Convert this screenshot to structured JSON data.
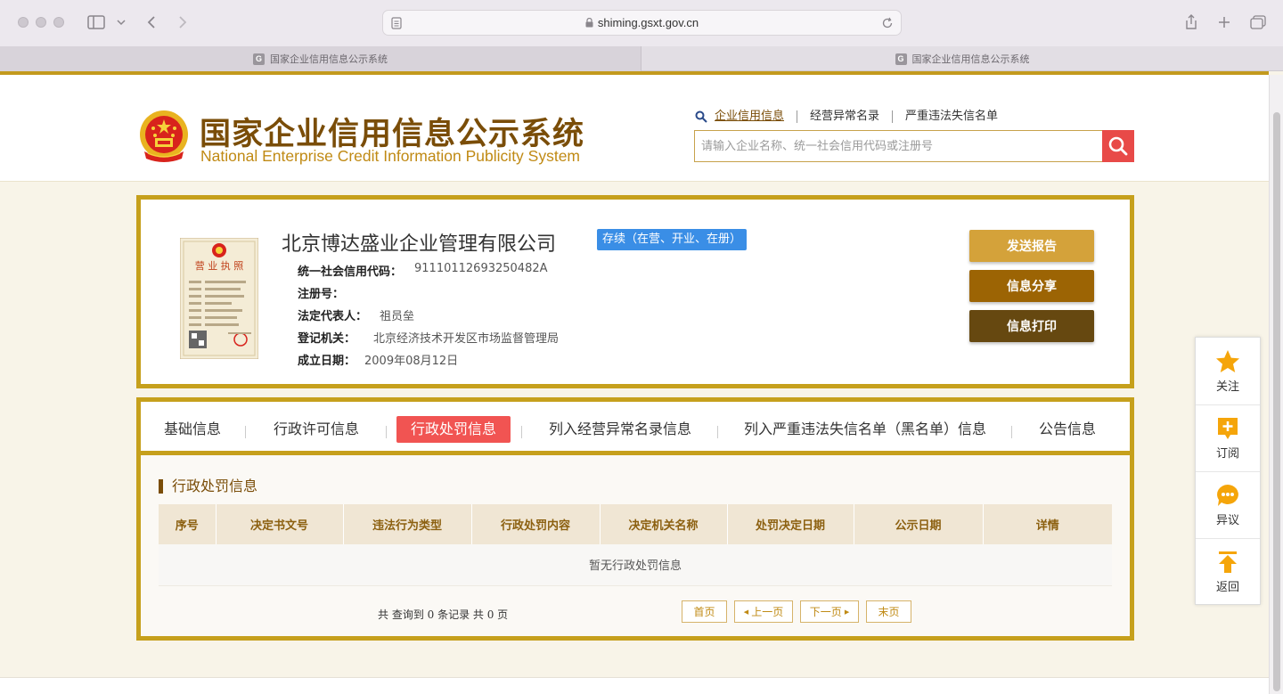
{
  "browser": {
    "url": "shiming.gsxt.gov.cn",
    "tabs": [
      {
        "title": "国家企业信用信息公示系统",
        "favicon": "G"
      },
      {
        "title": "国家企业信用信息公示系统",
        "favicon": "G"
      }
    ]
  },
  "header": {
    "title_cn": "国家企业信用信息公示系统",
    "title_en": "National Enterprise Credit Information Publicity System",
    "search_links": [
      "企业信用信息",
      "经营异常名录",
      "严重违法失信名单"
    ],
    "search_placeholder": "请输入企业名称、统一社会信用代码或注册号"
  },
  "company": {
    "name": "北京博达盛业企业管理有限公司",
    "status": "存续（在营、开业、在册）",
    "fields": [
      {
        "label": "统一社会信用代码：",
        "value": "91110112693250482A"
      },
      {
        "label": "注册号：",
        "value": ""
      },
      {
        "label": "法定代表人：",
        "value": "祖员垒"
      },
      {
        "label": "登记机关：",
        "value": "北京经济技术开发区市场监督管理局"
      },
      {
        "label": "成立日期：",
        "value": "2009年08月12日"
      }
    ],
    "actions": [
      "发送报告",
      "信息分享",
      "信息打印"
    ],
    "license_text": "营业执照"
  },
  "nav_tabs": [
    "基础信息",
    "行政许可信息",
    "行政处罚信息",
    "列入经营异常名录信息",
    "列入严重违法失信名单（黑名单）信息",
    "公告信息"
  ],
  "active_tab": "行政处罚信息",
  "section": {
    "title": "行政处罚信息",
    "columns": [
      "序号",
      "决定书文号",
      "违法行为类型",
      "行政处罚内容",
      "决定机关名称",
      "处罚决定日期",
      "公示日期",
      "详情"
    ],
    "empty_text": "暂无行政处罚信息",
    "summary": "共 查询到 0 条记录 共 0 页",
    "pager": [
      "首页",
      "上一页",
      "下一页",
      "末页"
    ]
  },
  "side_panel": [
    {
      "label": "关注",
      "icon": "star-icon"
    },
    {
      "label": "订阅",
      "icon": "subscribe-icon"
    },
    {
      "label": "异议",
      "icon": "comment-icon"
    },
    {
      "label": "返回",
      "icon": "back-to-top-icon"
    }
  ],
  "colors": {
    "gold_border": "#c6a01c",
    "brand_brown": "#7a4d08",
    "active_tab": "#f15452",
    "status_blue": "#3a8ee6",
    "btn_send": "#d4a23a",
    "btn_share": "#9c6404",
    "btn_print": "#664810"
  }
}
